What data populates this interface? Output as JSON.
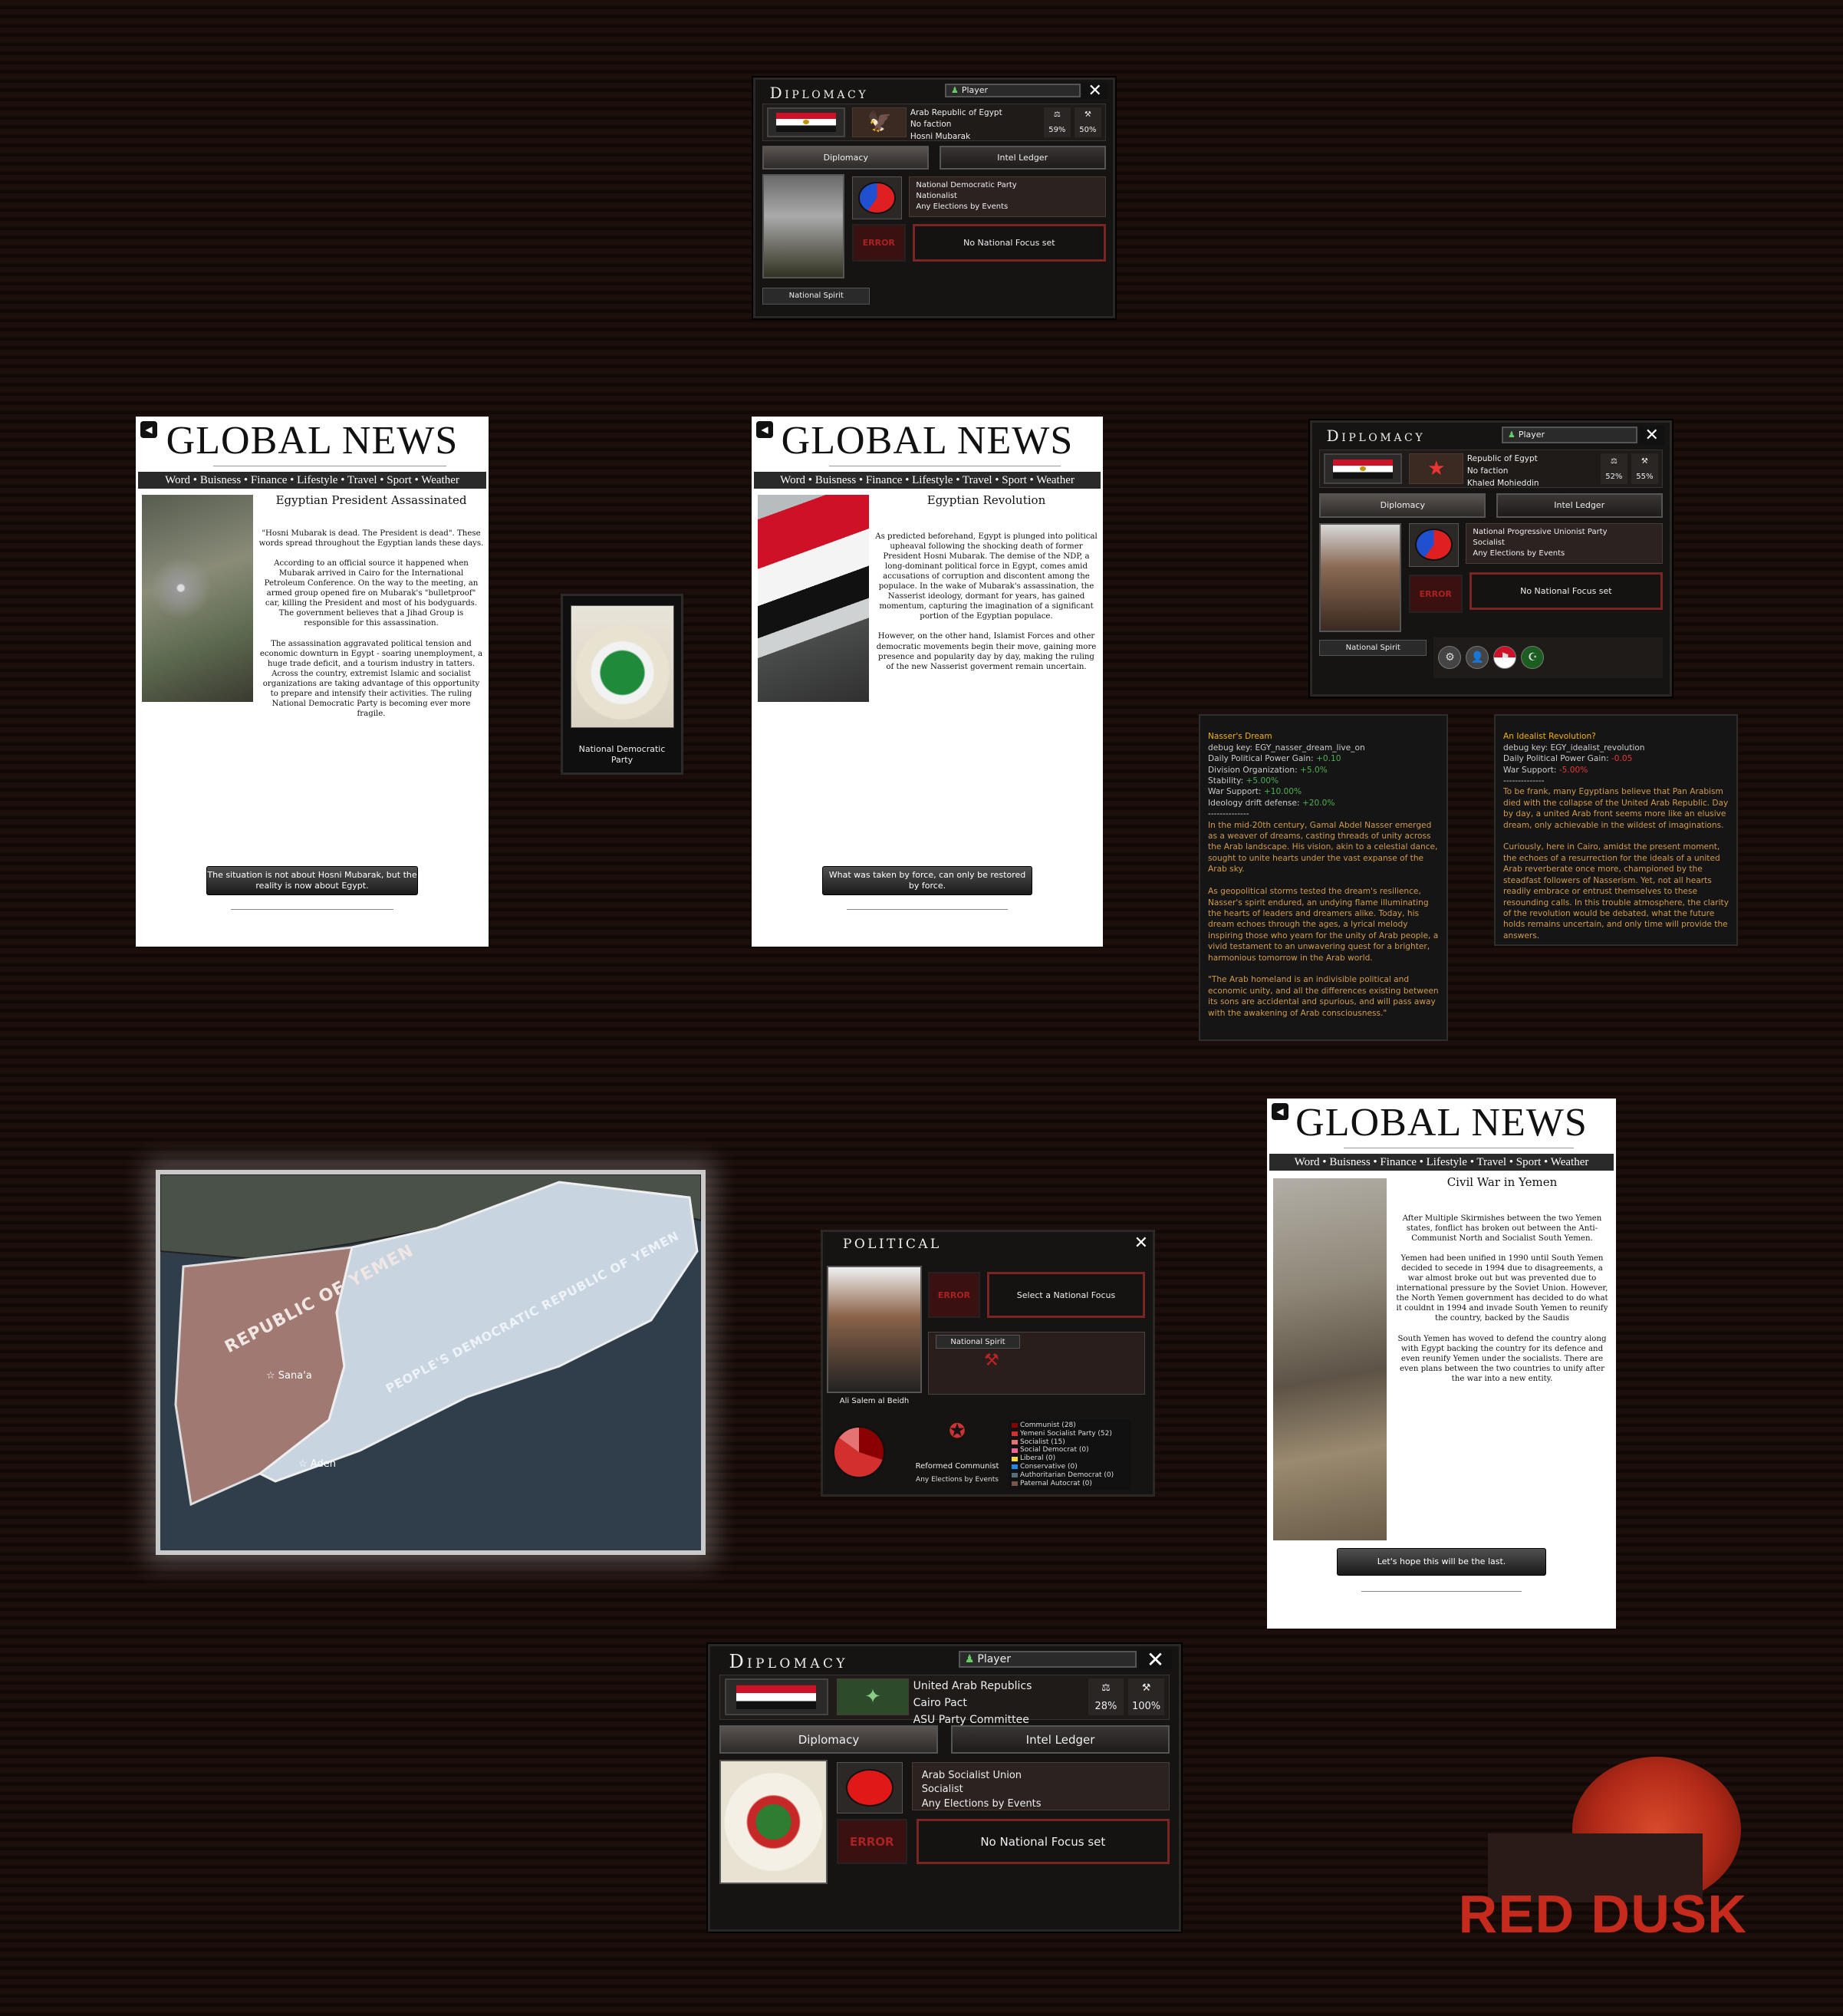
{
  "diplomacy_egypt_mubarak": {
    "title": "Diplomacy",
    "player": "Player",
    "country": "Arab Republic of Egypt",
    "faction": "No faction",
    "leader": "Hosni Mubarak",
    "stat1": "59%",
    "stat2": "50%",
    "tab_diplomacy": "Diplomacy",
    "tab_intel": "Intel Ledger",
    "party": "National Democratic Party",
    "ideology": "Nationalist",
    "elections": "Any Elections by Events",
    "error": "ERROR",
    "focus": "No National Focus set",
    "spirit": "National Spirit"
  },
  "diplomacy_egypt_mohieddin": {
    "title": "Diplomacy",
    "player": "Player",
    "country": "Republic of Egypt",
    "faction": "No faction",
    "leader": "Khaled Mohieddin",
    "stat1": "52%",
    "stat2": "55%",
    "tab_diplomacy": "Diplomacy",
    "tab_intel": "Intel Ledger",
    "party": "National Progressive Unionist Party",
    "ideology": "Socialist",
    "elections": "Any Elections by Events",
    "error": "ERROR",
    "focus": "No National Focus set",
    "spirit": "National Spirit"
  },
  "diplomacy_uar": {
    "title": "Diplomacy",
    "player": "Player",
    "country": "United Arab Republics",
    "faction": "Cairo Pact",
    "leader": "ASU Party Committee",
    "stat1": "28%",
    "stat2": "100%",
    "tab_diplomacy": "Diplomacy",
    "tab_intel": "Intel Ledger",
    "party": "Arab Socialist Union",
    "ideology": "Socialist",
    "elections": "Any Elections by Events",
    "error": "ERROR",
    "focus": "No National Focus set"
  },
  "news_nav": "Word • Buisness • Finance • Lifestyle • Travel • Sport • Weather",
  "news_masthead": "GLOBAL NEWS",
  "news1": {
    "headline": "Egyptian President Assassinated",
    "body": "\"Hosni Mubarak is dead. The President is dead\". These words spread throughout the Egyptian lands these days.\n\nAccording to an official source it happened when Mubarak arrived in Cairo for the International Petroleum Conference. On the way to the meeting, an armed group opened fire on Mubarak's \"bulletproof\" car, killing the President and most of his bodyguards. The government believes that a Jihad Group is responsible for this assassination.\n\nThe assassination aggravated political tension and economic downturn in Egypt - soaring unemployment, a huge trade deficit, and a tourism industry in tatters. Across the country, extremist Islamic and socialist organizations are taking advantage of this opportunity to prepare and intensify their activities. The ruling National Democratic Party is becoming ever more fragile.",
    "button": "The situation is not about Hosni Mubarak, but the reality is now about Egypt."
  },
  "news2": {
    "headline": "Egyptian Revolution",
    "body": "As predicted beforehand, Egypt is plunged into political upheaval following the shocking death of former President Hosni Mubarak. The demise of the NDP, a long-dominant political force in Egypt, comes amid accusations of corruption and discontent among the populace. In the wake of Mubarak's assassination, the Nasserist ideology, dormant for years, has gained momentum, capturing the imagination of a significant portion of the Egyptian populace.\n\nHowever, on the other hand, Islamist Forces and other democratic movements begin their move, gaining more presence and popularity day by day, making the ruling of the new Nasserist goverment remain uncertain.",
    "button": "What was taken by force, can only be restored by force."
  },
  "news3": {
    "headline": "Civil War in Yemen",
    "body": "After Multiple Skirmishes between the two Yemen states, fonflict has broken out between the Anti-Communist North and Socialist South Yemen.\n\nYemen had been unified in 1990 until South Yemen decided to secede in 1994 due to disagreements, a war almost broke out but was prevented due to international pressure by the Soviet Union. However, the North Yemen government has decided to do what it couldnt in 1994 and invade South Yemen to reunify the country, backed by the Saudis\n\nSouth Yemen has woved to defend the country along with Egypt backing the country for its defence and even reunify Yemen under the socialists. There are even plans between the two countries to unify after the war into a new entity.",
    "button": "Let's hope this will be the last."
  },
  "party_card": {
    "label": "National Democratic Party"
  },
  "tooltip_nasser": {
    "title": "Nasser's Dream",
    "debug": "debug key: EGY_nasser_dream_live_on",
    "pp_label": "Daily Political Power Gain: ",
    "pp_value": "+0.10",
    "org_label": "Division Organization: ",
    "org_value": "+5.0%",
    "stab_label": "Stability: ",
    "stab_value": "+5.00%",
    "war_label": "War Support: ",
    "war_value": "+10.00%",
    "drift_label": "Ideology drift defense: ",
    "drift_value": "+20.0%",
    "separator": "--------------",
    "desc": "In the mid-20th century, Gamal Abdel Nasser emerged as a weaver of dreams, casting threads of unity across the Arab landscape. His vision, akin to a celestial dance, sought to unite hearts under the vast expanse of the Arab sky.\n\nAs geopolitical storms tested the dream's resilience, Nasser's spirit endured, an undying flame illuminating the hearts of leaders and dreamers alike. Today, his dream echoes through the ages, a lyrical melody inspiring those who yearn for the unity of Arab people, a vivid testament to an unwavering quest for a brighter, harmonious tomorrow in the Arab world.\n\n\"The Arab homeland is an indivisible political and economic unity, and all the differences existing between its sons are accidental and spurious, and will pass away with the awakening of Arab consciousness.\""
  },
  "tooltip_idealist": {
    "title": "An Idealist Revolution?",
    "debug": "debug key: EGY_idealist_revolution",
    "pp_label": "Daily Political Power Gain: ",
    "pp_value": "-0.05",
    "war_label": "War Support: ",
    "war_value": "-5.00%",
    "separator": "--------------",
    "desc": "To be frank, many Egyptians believe that Pan Arabism died with the collapse of the United Arab Republic. Day by day, a united Arab front seems more like an elusive dream, only achievable in the wildest of imaginations.\n\nCuriously, here in Cairo, amidst the present moment, the echoes of a resurrection for the ideals of a united Arab reverberate once more, championed by the steadfast followers of Nasserism. Yet, not all hearts readily embrace or entrust themselves to these resounding calls. In this trouble atmosphere, the clarity of the revolution would be debated, what the future holds remains uncertain, and only time will provide the answers."
  },
  "map": {
    "north_label": "REPUBLIC OF YEMEN",
    "south_label": "PEOPLE'S DEMOCRATIC REPUBLIC OF YEMEN",
    "city1": "Sana'a",
    "city2": "Aden",
    "colors": {
      "north": "#a07a72",
      "south": "#c8d4e0",
      "sea": "#2f3e4a",
      "land": "#4a5148"
    }
  },
  "political": {
    "title": "Political",
    "leader": "Ali Salem al Beidh",
    "error": "ERROR",
    "focus": "Select a National Focus",
    "spirit": "National Spirit",
    "party_ideology": "Reformed Communist",
    "elections": "Any Elections by Events",
    "parties": [
      {
        "name": "Communist (28)",
        "color": "#8b0000"
      },
      {
        "name": "Yemeni Socialist Party (52)",
        "color": "#d32f2f"
      },
      {
        "name": "Socialist (15)",
        "color": "#e57373"
      },
      {
        "name": "Social Democrat (0)",
        "color": "#f06292"
      },
      {
        "name": "Liberal (0)",
        "color": "#fdd835"
      },
      {
        "name": "Conservative (0)",
        "color": "#1e88e5"
      },
      {
        "name": "Authoritarian Democrat (0)",
        "color": "#546e7a"
      },
      {
        "name": "Paternal Autocrat (0)",
        "color": "#795548"
      }
    ]
  },
  "logo": {
    "text": "RED DUSK"
  }
}
